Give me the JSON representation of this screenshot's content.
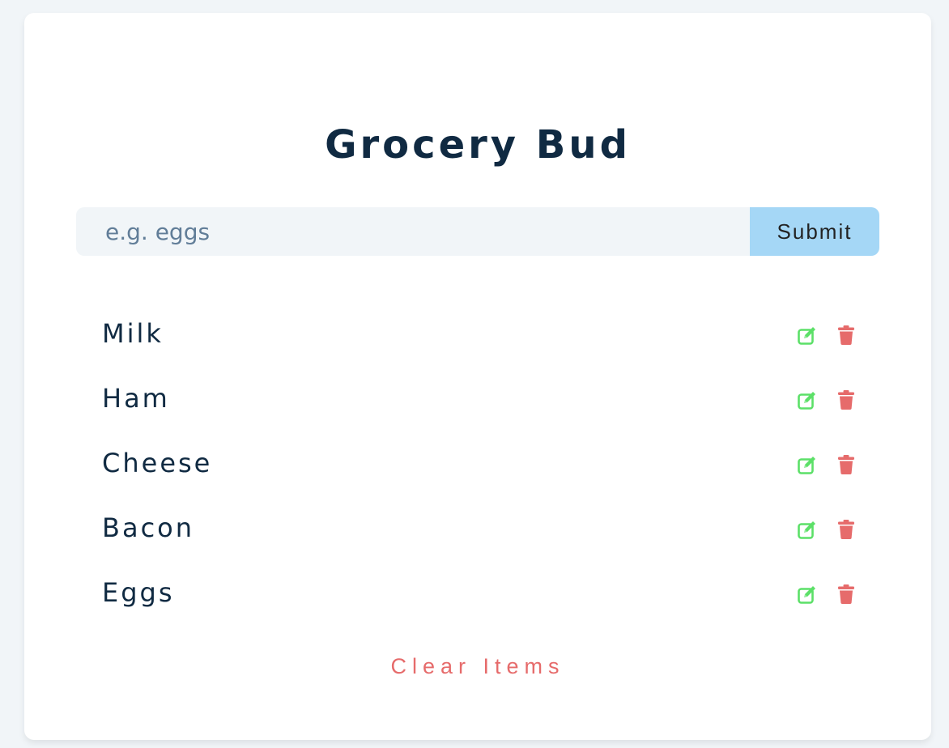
{
  "app": {
    "title": "Grocery Bud"
  },
  "form": {
    "placeholder": "e.g. eggs",
    "value": "",
    "submit_label": "Submit"
  },
  "items": [
    {
      "label": "Milk"
    },
    {
      "label": "Ham"
    },
    {
      "label": "Cheese"
    },
    {
      "label": "Bacon"
    },
    {
      "label": "Eggs"
    }
  ],
  "item_actions": {
    "edit_icon": "edit-icon",
    "delete_icon": "trash-icon"
  },
  "clear_label": "Clear Items",
  "colors": {
    "title": "#102a42",
    "submit_bg": "#a5d7f6",
    "input_bg": "#f1f5f8",
    "edit": "#5ce068",
    "delete": "#e66b6b",
    "clear": "#e66b6b"
  }
}
